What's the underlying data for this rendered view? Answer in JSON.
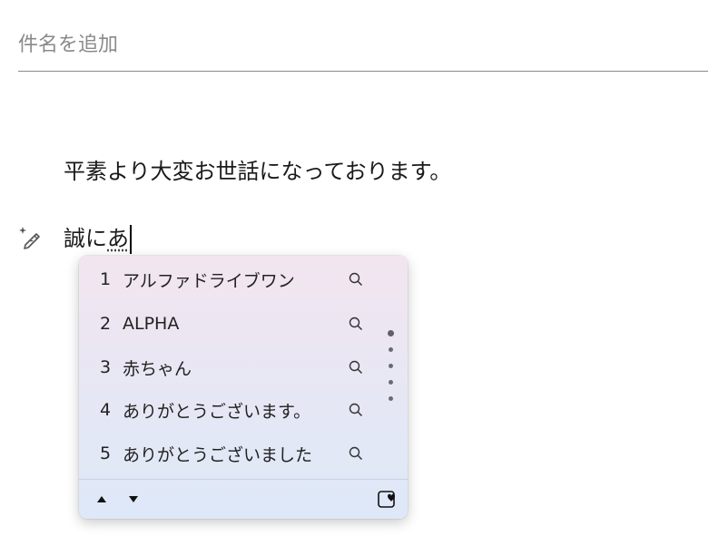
{
  "subject": {
    "placeholder": "件名を追加"
  },
  "body": {
    "line1": "平素より大変お世話になっております。",
    "line2_prefix": "誠に",
    "line2_composing": "あ"
  },
  "ime": {
    "candidates": [
      {
        "num": "1",
        "text": "アルファドライブワン"
      },
      {
        "num": "2",
        "text": "ALPHA"
      },
      {
        "num": "3",
        "text": "赤ちゃん"
      },
      {
        "num": "4",
        "text": "ありがとうございます。"
      },
      {
        "num": "5",
        "text": "ありがとうございました"
      }
    ],
    "scroll_position": 0,
    "colors": {
      "panel_top": "#f2e5ef",
      "panel_bottom": "#dde8f8"
    }
  }
}
